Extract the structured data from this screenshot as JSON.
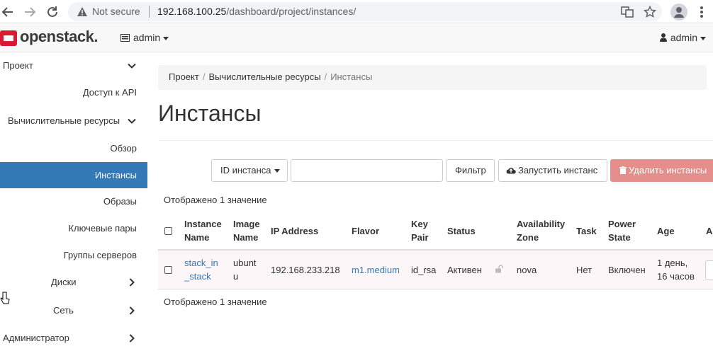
{
  "browser": {
    "not_secure": "Not secure",
    "url_host": "192.168.100.25",
    "url_path": "/dashboard/project/instances/"
  },
  "topbar": {
    "logo": "openstack.",
    "project": "admin",
    "user": "admin"
  },
  "sidebar": {
    "items": [
      {
        "label": "Проект",
        "icon": "chevron-down-icon"
      },
      {
        "label": "Доступ к API"
      },
      {
        "label": "Вычислительные ресурсы",
        "icon": "chevron-down-icon"
      },
      {
        "label": "Обзор"
      },
      {
        "label": "Инстансы",
        "active": true
      },
      {
        "label": "Образы"
      },
      {
        "label": "Ключевые пары"
      },
      {
        "label": "Группы серверов"
      },
      {
        "label": "Диски",
        "icon": "chevron-right-icon"
      },
      {
        "label": "Сеть",
        "icon": "chevron-right-icon"
      },
      {
        "label": "Администратор",
        "icon": "chevron-right-icon"
      }
    ]
  },
  "breadcrumb": [
    "Проект",
    "Вычислительные ресурсы",
    "Инстансы"
  ],
  "page_title": "Инстансы",
  "toolbar": {
    "filter_field": "ID инстанса",
    "filter_value": "",
    "filter_button": "Фильтр",
    "launch_button": "Запустить инстанс",
    "delete_button": "Удалить инстансы"
  },
  "count_text": "Отображено 1 значение",
  "table": {
    "headers": {
      "instance_name": [
        "Instance",
        "Name"
      ],
      "image_name": [
        "Image",
        "Name"
      ],
      "ip": "IP Address",
      "flavor": "Flavor",
      "key_pair": [
        "Key",
        "Pair"
      ],
      "status": "Status",
      "az": [
        "Availability",
        "Zone"
      ],
      "task": "Task",
      "power": [
        "Power",
        "State"
      ],
      "age": "Age",
      "actions": "Ac"
    },
    "rows": [
      {
        "instance_name": [
          "stack_in",
          "_stack"
        ],
        "image_name": [
          "ubunt",
          "u"
        ],
        "ip": "192.168.233.218",
        "flavor": "m1.medium",
        "key_pair": "id_rsa",
        "status": "Активен",
        "az": "nova",
        "task": "Нет",
        "power": "Включен",
        "age": [
          "1 день,",
          "16 часов"
        ]
      }
    ]
  },
  "colors": {
    "primary": "#337ab7",
    "danger_disabled": "#e48f8c",
    "brand_red": "#da1a32"
  }
}
